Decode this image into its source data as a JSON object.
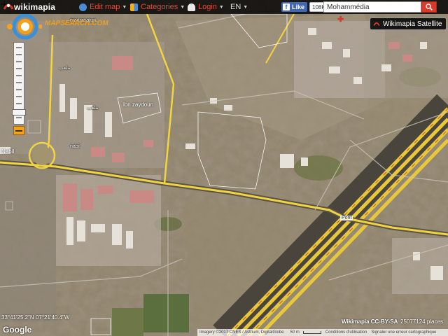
{
  "app": {
    "name": "wikimapia"
  },
  "menu": {
    "edit_map": "Edit map",
    "categories": "Categories",
    "login": "Login",
    "language": "EN"
  },
  "facebook": {
    "like": "Like",
    "count": "108K"
  },
  "search": {
    "value": "Mohammédia"
  },
  "map_type": {
    "label": "Wikimapia Satellite"
  },
  "mapsearch_logo": "MAPSEARCH.COM",
  "map_labels": {
    "ibn_zaydoun": "ibn zaydoun",
    "nabil": "Nabil",
    "top_small": "madrasatun",
    "small1": "ملعب",
    "small2": "ملعب",
    "small3": "nabil"
  },
  "road_label": "Pont",
  "status": {
    "coordinates": "33°41'25.2\"N 07°21'40.4\"W",
    "google": "Google",
    "license": "Wikimapia CC-BY-SA",
    "places": "25077124 places"
  },
  "footer": {
    "imagery": "Imagery ©2017 CNES / Astrium, DigitalGlobe",
    "scale": "50 m",
    "terms": "Conditions d'utilisation",
    "report": "Signaler une erreur cartographique"
  },
  "colors": {
    "accent": "#d93a2b",
    "road": "#f2d440",
    "highway": "#e8c83a",
    "menu_text": "#e04a3a"
  }
}
